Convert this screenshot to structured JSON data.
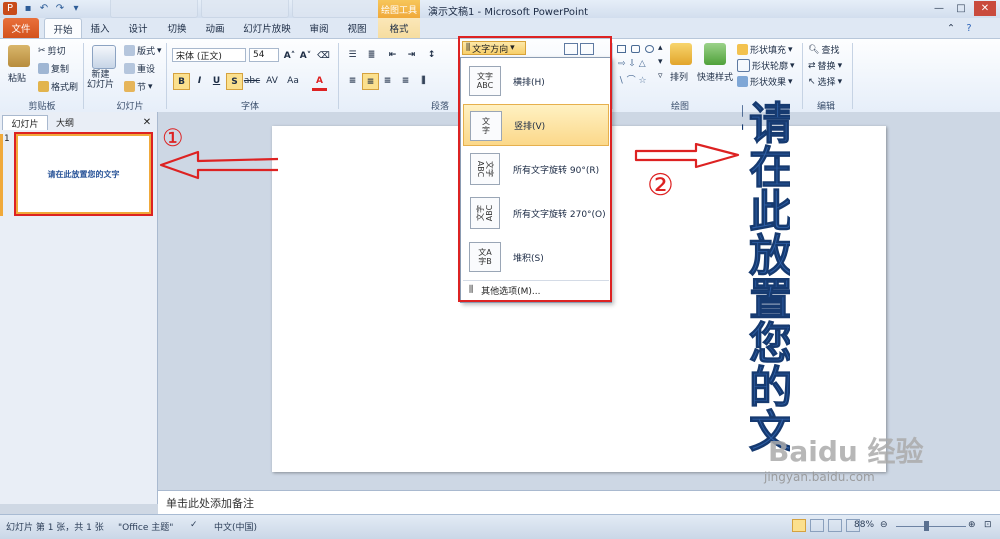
{
  "title_bar": {
    "window_title": "演示文稿1 - Microsoft PowerPoint",
    "context_tab": "绘图工具",
    "qa_icons": [
      "save-icon",
      "undo-icon",
      "redo-icon",
      "customize-icon"
    ]
  },
  "tabs": [
    "文件",
    "开始",
    "插入",
    "设计",
    "切换",
    "动画",
    "幻灯片放映",
    "审阅",
    "视图",
    "格式"
  ],
  "ribbon": {
    "clipboard": {
      "paste": "粘贴",
      "cut": "剪切",
      "copy": "复制",
      "format_painter": "格式刷",
      "label": "剪贴板"
    },
    "slides": {
      "new_slide": "新建\n幻灯片",
      "layout": "版式",
      "reset": "重设",
      "section": "节",
      "label": "幻灯片"
    },
    "font": {
      "font_name": "宋体 (正文)",
      "font_size": "54",
      "bold": "B",
      "italic": "I",
      "underline": "U",
      "shadow": "S",
      "strike": "abc",
      "spacing": "AV",
      "case": "Aa",
      "color": "A",
      "label": "字体"
    },
    "paragraph": {
      "label": "段落"
    },
    "drawing": {
      "arrange": "排列",
      "quick_styles": "快速样式",
      "shape_fill": "形状填充",
      "shape_outline": "形状轮廓",
      "shape_effects": "形状效果",
      "label": "绘图"
    },
    "editing": {
      "find": "查找",
      "replace": "替换",
      "select": "选择",
      "label": "编辑"
    }
  },
  "text_direction": {
    "button_label": "文字方向",
    "items": [
      {
        "label": "横排(H)",
        "icon_text": "文字\nABC"
      },
      {
        "label": "竖排(V)",
        "icon_text": "文\n字"
      },
      {
        "label": "所有文字旋转 90°(R)",
        "icon_text": "文字\nABC"
      },
      {
        "label": "所有文字旋转 270°(O)",
        "icon_text": "文字\nABC"
      },
      {
        "label": "堆积(S)",
        "icon_text": "文A\n字B"
      }
    ],
    "more_options": "其他选项(M)..."
  },
  "left_panel": {
    "tab_slides": "幻灯片",
    "tab_outline": "大纲",
    "slide_number": "1",
    "thumbnail_text": "请在此放置您的文字"
  },
  "slide": {
    "vertical_text": "请在此放置您的文字"
  },
  "notes": {
    "placeholder": "单击此处添加备注"
  },
  "status": {
    "slide_info": "幻灯片 第 1 张，共 1 张",
    "theme": "\"Office 主题\"",
    "language": "中文(中国)",
    "zoom": "88%"
  },
  "annotations": {
    "mark1": "①",
    "mark2": "②"
  },
  "watermark": {
    "logo": "Baidu 经验",
    "url": "jingyan.baidu.com"
  },
  "colors": {
    "accent_red": "#d22222",
    "ribbon_blue": "#dfe8f4",
    "highlight": "#fbd88a",
    "text_blue": "#2e5fa6"
  }
}
